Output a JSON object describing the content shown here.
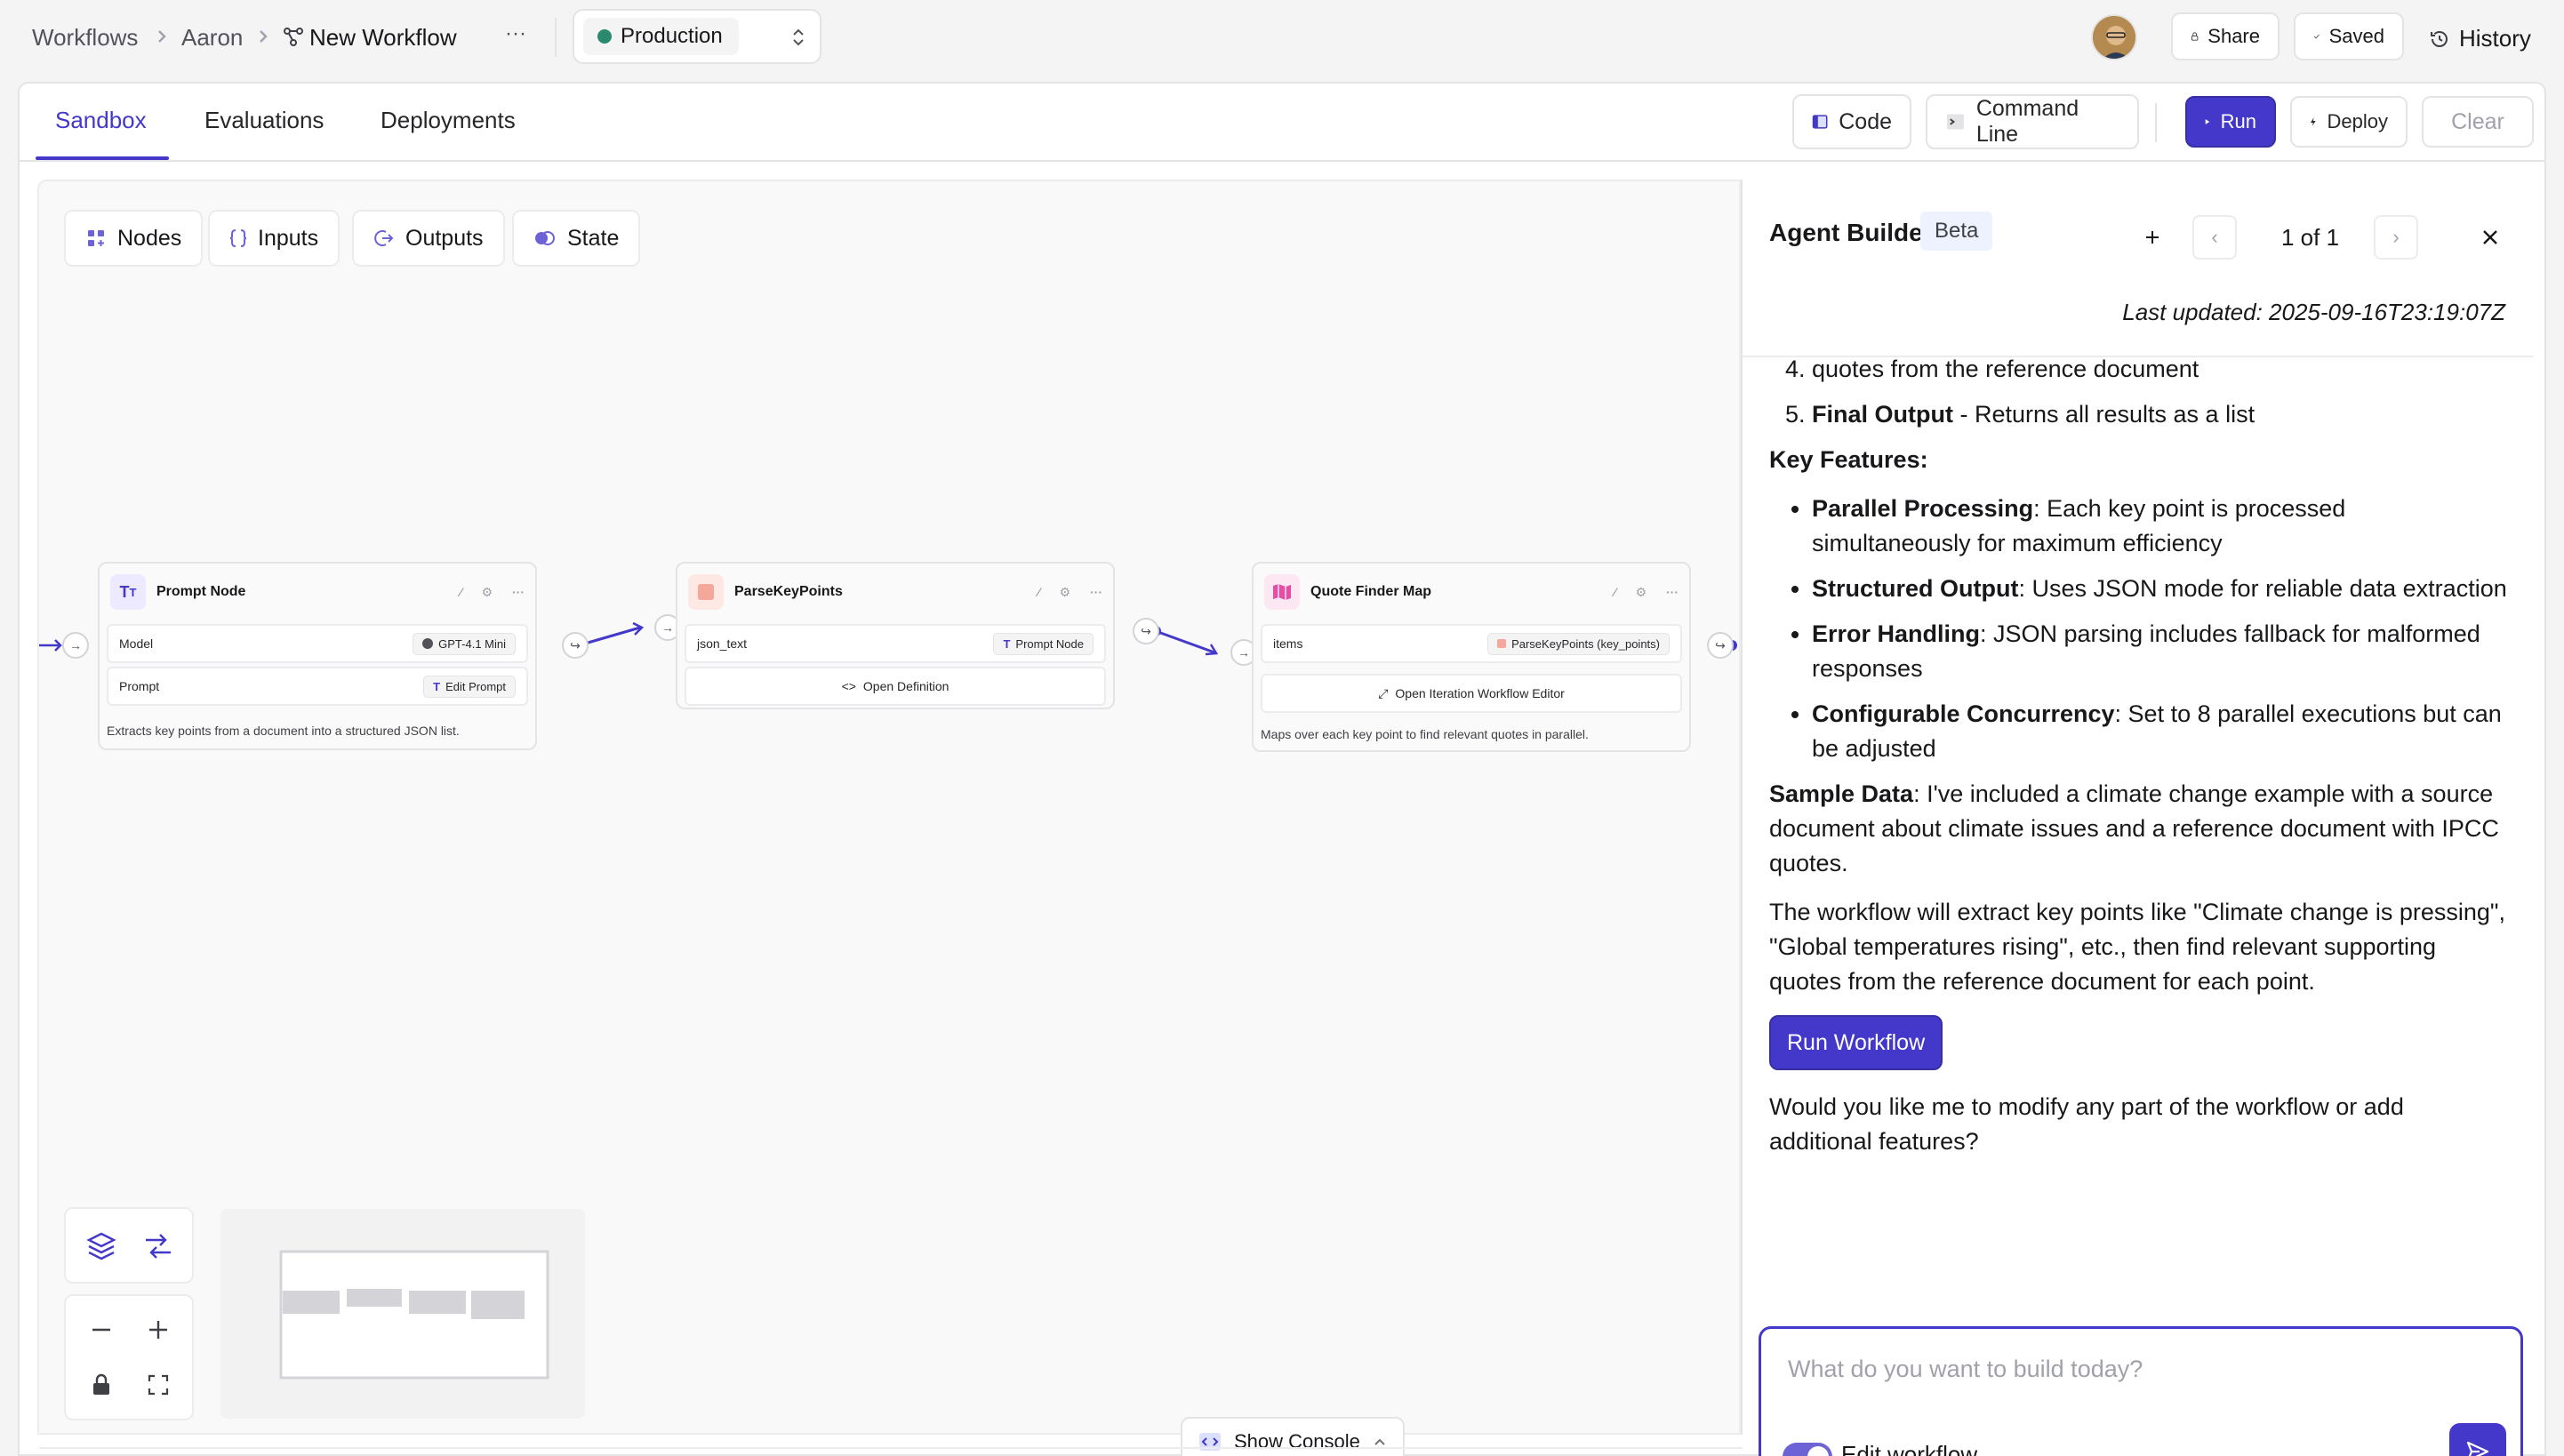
{
  "breadcrumb": {
    "root": "Workflows",
    "owner": "Aaron",
    "current": "New Workflow",
    "more": "···"
  },
  "environment": {
    "selected": "Production",
    "color": "#2b8a6e"
  },
  "header_actions": {
    "share": "Share",
    "saved": "Saved",
    "history": "History"
  },
  "tabs": [
    {
      "label": "Sandbox",
      "active": true
    },
    {
      "label": "Evaluations"
    },
    {
      "label": "Deployments"
    }
  ],
  "toolbar": {
    "code": "Code",
    "command_line": "Command Line",
    "run": "Run",
    "deploy": "Deploy",
    "clear": "Clear"
  },
  "canvas_chips": {
    "nodes": "Nodes",
    "inputs": "Inputs",
    "outputs": "Outputs",
    "state": "State"
  },
  "nodes": {
    "prompt": {
      "title": "Prompt Node",
      "model_label": "Model",
      "model_value": "GPT-4.1 Mini",
      "prompt_label": "Prompt",
      "prompt_action": "Edit Prompt",
      "description": "Extracts key points from a document into a structured JSON list."
    },
    "parse": {
      "title": "ParseKeyPoints",
      "input_label": "json_text",
      "input_value": "Prompt Node",
      "action": "Open Definition"
    },
    "map": {
      "title": "Quote Finder Map",
      "items_label": "items",
      "items_value": "ParseKeyPoints (key_points)",
      "action": "Open Iteration Workflow Editor",
      "description": "Maps over each key point to find relevant quotes in parallel."
    }
  },
  "console": {
    "label": "Show Console"
  },
  "agent": {
    "title": "Agent Builder",
    "badge": "Beta",
    "pager": "1 of 1",
    "updated": "Last updated: 2025-09-16T23:19:07Z",
    "partial_item_text": "quotes from the reference document",
    "step5_bold": "Final Output",
    "step5_text": " - Returns all results as a list",
    "features_heading": "Key Features:",
    "features": [
      {
        "bold": "Parallel Processing",
        "text": ": Each key point is processed simultaneously for maximum efficiency"
      },
      {
        "bold": "Structured Output",
        "text": ": Uses JSON mode for reliable data extraction"
      },
      {
        "bold": "Error Handling",
        "text": ": JSON parsing includes fallback for malformed responses"
      },
      {
        "bold": "Configurable Concurrency",
        "text": ": Set to 8 parallel executions but can be adjusted"
      }
    ],
    "sample_bold": "Sample Data",
    "sample_text": ": I've included a climate change example with a source document about climate issues and a reference document with IPCC quotes.",
    "explanation": "The workflow will extract key points like \"Climate change is pressing\", \"Global temperatures rising\", etc., then find relevant supporting quotes from the reference document for each point.",
    "run_workflow": "Run Workflow",
    "question": "Would you like me to modify any part of the workflow or add additional features?",
    "composer_placeholder": "What do you want to build today?",
    "edit_toggle_label": "Edit workflow",
    "edit_toggle_on": true
  },
  "colors": {
    "accent": "#4338ca",
    "env_dot": "#2b8a6e"
  }
}
